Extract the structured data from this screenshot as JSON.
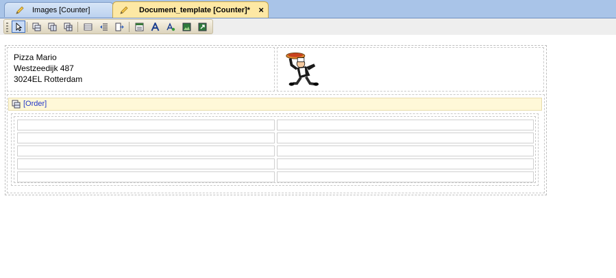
{
  "tabs": [
    {
      "label": "Images [Counter]",
      "active": false
    },
    {
      "label": "Document_template [Counter]*",
      "active": true,
      "close": "×"
    }
  ],
  "toolbar": {
    "buttons": [
      "pointer-icon",
      "insert-table-icon",
      "insert-row-icon",
      "insert-column-icon",
      "grid-icon",
      "indent-left-icon",
      "indent-right-icon",
      "field-icon",
      "text-icon",
      "text-style-icon",
      "image-icon",
      "image-link-icon"
    ]
  },
  "header": {
    "address": [
      "Pizza  Mario",
      "Westzeedijk 487",
      "3024EL Rotterdam"
    ],
    "logo": "pizza-chef-icon"
  },
  "order": {
    "label": "[Order]"
  },
  "colors": {
    "tabstrip": "#a9c4e8",
    "active_tab": "#fde8a4",
    "order_bar": "#fff8d8",
    "order_text": "#1f34c9"
  }
}
